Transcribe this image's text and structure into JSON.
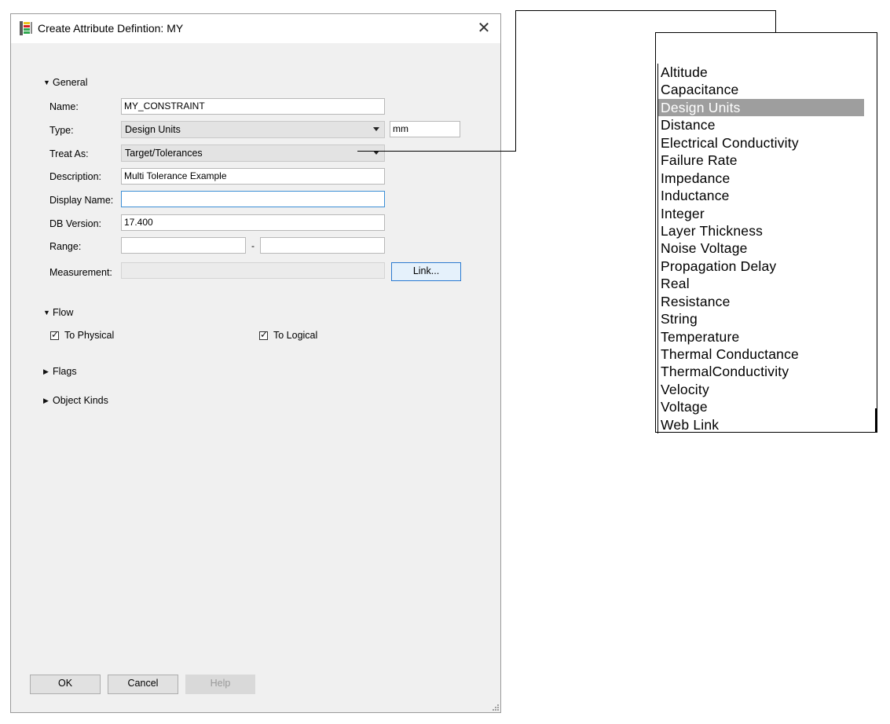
{
  "dialog": {
    "title": "Create Attribute Defintion:  MY",
    "close_glyph": "✕",
    "icons": {
      "app": "attribute-table-icon",
      "close": "close-icon",
      "resize": "resize-grip-icon"
    }
  },
  "general": {
    "header": "General",
    "name": {
      "label": "Name:",
      "value": "MY_CONSTRAINT"
    },
    "type": {
      "label": "Type:",
      "value": "Design Units",
      "unit": "mm"
    },
    "treat_as": {
      "label": "Treat As:",
      "value": "Target/Tolerances"
    },
    "description": {
      "label": "Description:",
      "value": "Multi Tolerance Example"
    },
    "display_name": {
      "label": "Display Name:",
      "value": ""
    },
    "db_version": {
      "label": "DB Version:",
      "value": "17.400"
    },
    "range": {
      "label": "Range:",
      "min": "",
      "separator": "-",
      "max": ""
    },
    "measurement": {
      "label": "Measurement:",
      "value": "",
      "link_button": "Link..."
    }
  },
  "flow": {
    "header": "Flow",
    "to_physical": {
      "label": "To Physical",
      "checked": true
    },
    "to_logical": {
      "label": "To Logical",
      "checked": true
    }
  },
  "flags": {
    "header": "Flags"
  },
  "object_kinds": {
    "header": "Object Kinds"
  },
  "buttons": {
    "ok": "OK",
    "cancel": "Cancel",
    "help": "Help"
  },
  "type_list": {
    "selected": "Design Units",
    "items": [
      "Altitude",
      "Capacitance",
      "Design Units",
      "Distance",
      "Electrical Conductivity",
      "Failure Rate",
      "Impedance",
      "Inductance",
      "Integer",
      "Layer Thickness",
      "Noise Voltage",
      "Propagation Delay",
      "Real",
      "Resistance",
      "String",
      "Temperature",
      "Thermal Conductance",
      "ThermalConductivity",
      "Velocity",
      "Voltage",
      "Web Link"
    ]
  },
  "colors": {
    "focus_border": "#3c8fd6",
    "selection": "#9e9e9e",
    "dialog_bg": "#f0f0f0"
  }
}
